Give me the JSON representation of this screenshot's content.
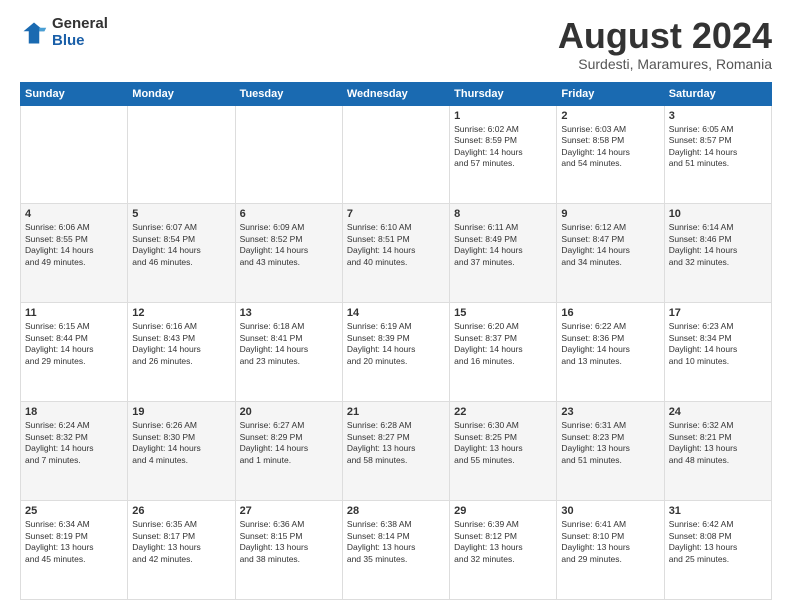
{
  "logo": {
    "general": "General",
    "blue": "Blue"
  },
  "header": {
    "title": "August 2024",
    "subtitle": "Surdesti, Maramures, Romania"
  },
  "days_of_week": [
    "Sunday",
    "Monday",
    "Tuesday",
    "Wednesday",
    "Thursday",
    "Friday",
    "Saturday"
  ],
  "weeks": [
    [
      {
        "day": "",
        "info": ""
      },
      {
        "day": "",
        "info": ""
      },
      {
        "day": "",
        "info": ""
      },
      {
        "day": "",
        "info": ""
      },
      {
        "day": "1",
        "info": "Sunrise: 6:02 AM\nSunset: 8:59 PM\nDaylight: 14 hours\nand 57 minutes."
      },
      {
        "day": "2",
        "info": "Sunrise: 6:03 AM\nSunset: 8:58 PM\nDaylight: 14 hours\nand 54 minutes."
      },
      {
        "day": "3",
        "info": "Sunrise: 6:05 AM\nSunset: 8:57 PM\nDaylight: 14 hours\nand 51 minutes."
      }
    ],
    [
      {
        "day": "4",
        "info": "Sunrise: 6:06 AM\nSunset: 8:55 PM\nDaylight: 14 hours\nand 49 minutes."
      },
      {
        "day": "5",
        "info": "Sunrise: 6:07 AM\nSunset: 8:54 PM\nDaylight: 14 hours\nand 46 minutes."
      },
      {
        "day": "6",
        "info": "Sunrise: 6:09 AM\nSunset: 8:52 PM\nDaylight: 14 hours\nand 43 minutes."
      },
      {
        "day": "7",
        "info": "Sunrise: 6:10 AM\nSunset: 8:51 PM\nDaylight: 14 hours\nand 40 minutes."
      },
      {
        "day": "8",
        "info": "Sunrise: 6:11 AM\nSunset: 8:49 PM\nDaylight: 14 hours\nand 37 minutes."
      },
      {
        "day": "9",
        "info": "Sunrise: 6:12 AM\nSunset: 8:47 PM\nDaylight: 14 hours\nand 34 minutes."
      },
      {
        "day": "10",
        "info": "Sunrise: 6:14 AM\nSunset: 8:46 PM\nDaylight: 14 hours\nand 32 minutes."
      }
    ],
    [
      {
        "day": "11",
        "info": "Sunrise: 6:15 AM\nSunset: 8:44 PM\nDaylight: 14 hours\nand 29 minutes."
      },
      {
        "day": "12",
        "info": "Sunrise: 6:16 AM\nSunset: 8:43 PM\nDaylight: 14 hours\nand 26 minutes."
      },
      {
        "day": "13",
        "info": "Sunrise: 6:18 AM\nSunset: 8:41 PM\nDaylight: 14 hours\nand 23 minutes."
      },
      {
        "day": "14",
        "info": "Sunrise: 6:19 AM\nSunset: 8:39 PM\nDaylight: 14 hours\nand 20 minutes."
      },
      {
        "day": "15",
        "info": "Sunrise: 6:20 AM\nSunset: 8:37 PM\nDaylight: 14 hours\nand 16 minutes."
      },
      {
        "day": "16",
        "info": "Sunrise: 6:22 AM\nSunset: 8:36 PM\nDaylight: 14 hours\nand 13 minutes."
      },
      {
        "day": "17",
        "info": "Sunrise: 6:23 AM\nSunset: 8:34 PM\nDaylight: 14 hours\nand 10 minutes."
      }
    ],
    [
      {
        "day": "18",
        "info": "Sunrise: 6:24 AM\nSunset: 8:32 PM\nDaylight: 14 hours\nand 7 minutes."
      },
      {
        "day": "19",
        "info": "Sunrise: 6:26 AM\nSunset: 8:30 PM\nDaylight: 14 hours\nand 4 minutes."
      },
      {
        "day": "20",
        "info": "Sunrise: 6:27 AM\nSunset: 8:29 PM\nDaylight: 14 hours\nand 1 minute."
      },
      {
        "day": "21",
        "info": "Sunrise: 6:28 AM\nSunset: 8:27 PM\nDaylight: 13 hours\nand 58 minutes."
      },
      {
        "day": "22",
        "info": "Sunrise: 6:30 AM\nSunset: 8:25 PM\nDaylight: 13 hours\nand 55 minutes."
      },
      {
        "day": "23",
        "info": "Sunrise: 6:31 AM\nSunset: 8:23 PM\nDaylight: 13 hours\nand 51 minutes."
      },
      {
        "day": "24",
        "info": "Sunrise: 6:32 AM\nSunset: 8:21 PM\nDaylight: 13 hours\nand 48 minutes."
      }
    ],
    [
      {
        "day": "25",
        "info": "Sunrise: 6:34 AM\nSunset: 8:19 PM\nDaylight: 13 hours\nand 45 minutes."
      },
      {
        "day": "26",
        "info": "Sunrise: 6:35 AM\nSunset: 8:17 PM\nDaylight: 13 hours\nand 42 minutes."
      },
      {
        "day": "27",
        "info": "Sunrise: 6:36 AM\nSunset: 8:15 PM\nDaylight: 13 hours\nand 38 minutes."
      },
      {
        "day": "28",
        "info": "Sunrise: 6:38 AM\nSunset: 8:14 PM\nDaylight: 13 hours\nand 35 minutes."
      },
      {
        "day": "29",
        "info": "Sunrise: 6:39 AM\nSunset: 8:12 PM\nDaylight: 13 hours\nand 32 minutes."
      },
      {
        "day": "30",
        "info": "Sunrise: 6:41 AM\nSunset: 8:10 PM\nDaylight: 13 hours\nand 29 minutes."
      },
      {
        "day": "31",
        "info": "Sunrise: 6:42 AM\nSunset: 8:08 PM\nDaylight: 13 hours\nand 25 minutes."
      }
    ]
  ]
}
